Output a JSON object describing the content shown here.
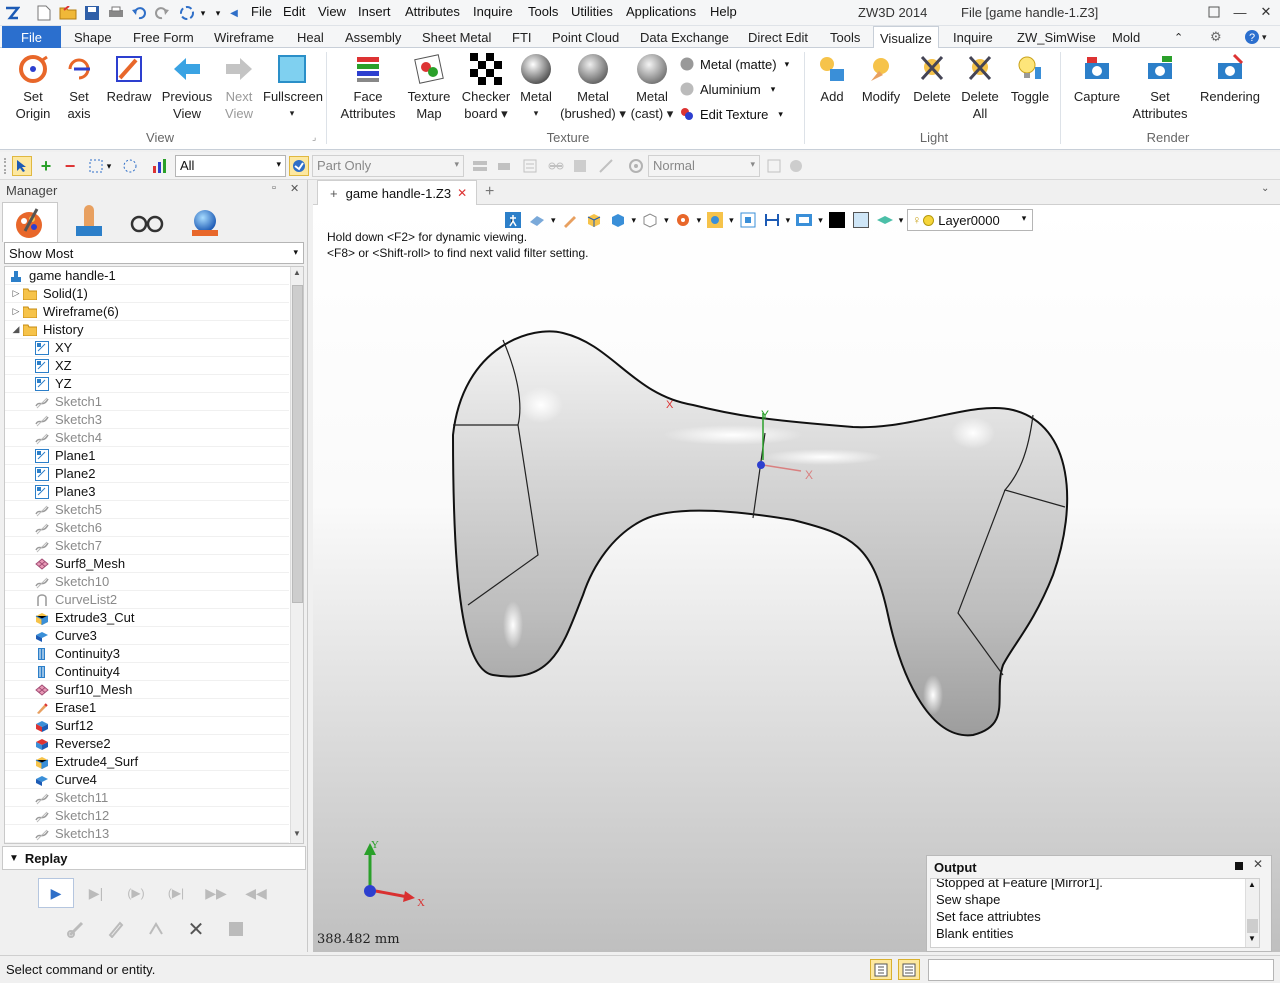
{
  "titlebar": {
    "menus": [
      "File",
      "Edit",
      "View",
      "Insert",
      "Attributes",
      "Inquire",
      "Tools",
      "Utilities",
      "Applications",
      "Help"
    ],
    "app_name": "ZW3D 2014",
    "file_title": "File [game handle-1.Z3]"
  },
  "tabs": [
    "File",
    "Shape",
    "Free Form",
    "Wireframe",
    "Heal",
    "Sheet Metal",
    "Assembly",
    "Sheet Metal",
    "FTI",
    "Point Cloud",
    "Data Exchange",
    "Direct Edit",
    "Tools",
    "Visualize",
    "Inquire",
    "ZW_SimWise",
    "Mold"
  ],
  "tabs_visible": [
    "File",
    "Shape",
    "Free Form",
    "Wireframe",
    "Heal",
    "Assembly",
    "Sheet Metal",
    "FTI",
    "Point Cloud",
    "Data Exchange",
    "Direct Edit",
    "Tools",
    "Visualize",
    "Inquire",
    "ZW_SimWise",
    "Mold"
  ],
  "ribbon": {
    "view": {
      "set_origin": [
        "Set",
        "Origin"
      ],
      "set_axis": [
        "Set",
        "axis"
      ],
      "redraw": [
        "Redraw",
        ""
      ],
      "previous_view": [
        "Previous",
        "View"
      ],
      "next_view": [
        "Next",
        "View"
      ],
      "fullscreen": [
        "Fullscreen",
        "▾"
      ],
      "group": "View"
    },
    "texture": {
      "face_attributes": [
        "Face",
        "Attributes"
      ],
      "texture_map": [
        "Texture",
        "Map"
      ],
      "checker_board": [
        "Checker",
        "board ▾"
      ],
      "metal": [
        "Metal",
        "▾"
      ],
      "metal_brushed": [
        "Metal",
        "(brushed) ▾"
      ],
      "metal_cast": [
        "Metal",
        "(cast) ▾"
      ],
      "small": [
        "Metal (matte)",
        "Aluminium",
        "Edit Texture"
      ],
      "group": "Texture"
    },
    "light": {
      "add": "Add",
      "modify": "Modify",
      "delete": "Delete",
      "delete_all": [
        "Delete",
        "All"
      ],
      "toggle": "Toggle",
      "group": "Light"
    },
    "render": {
      "capture": "Capture",
      "set_attributes": [
        "Set",
        "Attributes"
      ],
      "rendering": "Rendering",
      "group": "Render"
    }
  },
  "toolbar": {
    "filter_value": "All",
    "part_only": "Part Only",
    "normal": "Normal"
  },
  "manager": {
    "title": "Manager",
    "show_filter": "Show Most",
    "tree": [
      {
        "label": "game handle-1",
        "icon": "part-icon",
        "state": "normal",
        "indent": 0,
        "exp": ""
      },
      {
        "label": "Solid(1)",
        "icon": "folder-icon",
        "state": "normal",
        "indent": 1,
        "exp": "▷"
      },
      {
        "label": "Wireframe(6)",
        "icon": "folder-icon",
        "state": "normal",
        "indent": 1,
        "exp": "▷"
      },
      {
        "label": "History",
        "icon": "folder-icon",
        "state": "normal",
        "indent": 1,
        "exp": "◢"
      },
      {
        "label": "XY",
        "icon": "plane-icon",
        "state": "normal",
        "indent": 2,
        "exp": ""
      },
      {
        "label": "XZ",
        "icon": "plane-icon",
        "state": "normal",
        "indent": 2,
        "exp": ""
      },
      {
        "label": "YZ",
        "icon": "plane-icon",
        "state": "normal",
        "indent": 2,
        "exp": ""
      },
      {
        "label": "Sketch1",
        "icon": "sketch-icon",
        "state": "gray",
        "indent": 2,
        "exp": ""
      },
      {
        "label": "Sketch3",
        "icon": "sketch-icon",
        "state": "gray",
        "indent": 2,
        "exp": ""
      },
      {
        "label": "Sketch4",
        "icon": "sketch-icon",
        "state": "gray",
        "indent": 2,
        "exp": ""
      },
      {
        "label": "Plane1",
        "icon": "plane-icon",
        "state": "normal",
        "indent": 2,
        "exp": ""
      },
      {
        "label": "Plane2",
        "icon": "plane-icon",
        "state": "normal",
        "indent": 2,
        "exp": ""
      },
      {
        "label": "Plane3",
        "icon": "plane-icon",
        "state": "normal",
        "indent": 2,
        "exp": ""
      },
      {
        "label": "Sketch5",
        "icon": "sketch-icon",
        "state": "gray",
        "indent": 2,
        "exp": ""
      },
      {
        "label": "Sketch6",
        "icon": "sketch-icon",
        "state": "gray",
        "indent": 2,
        "exp": ""
      },
      {
        "label": "Sketch7",
        "icon": "sketch-icon",
        "state": "gray",
        "indent": 2,
        "exp": ""
      },
      {
        "label": "Surf8_Mesh",
        "icon": "mesh-icon",
        "state": "normal",
        "indent": 2,
        "exp": ""
      },
      {
        "label": "Sketch10",
        "icon": "sketch-icon",
        "state": "gray",
        "indent": 2,
        "exp": ""
      },
      {
        "label": "CurveList2",
        "icon": "curvelist-icon",
        "state": "gray",
        "indent": 2,
        "exp": ""
      },
      {
        "label": "Extrude3_Cut",
        "icon": "extrude-icon",
        "state": "normal",
        "indent": 2,
        "exp": ""
      },
      {
        "label": "Curve3",
        "icon": "curve-icon",
        "state": "normal",
        "indent": 2,
        "exp": ""
      },
      {
        "label": "Continuity3",
        "icon": "continuity-icon",
        "state": "normal",
        "indent": 2,
        "exp": ""
      },
      {
        "label": "Continuity4",
        "icon": "continuity-icon",
        "state": "normal",
        "indent": 2,
        "exp": ""
      },
      {
        "label": "Surf10_Mesh",
        "icon": "mesh-icon",
        "state": "normal",
        "indent": 2,
        "exp": ""
      },
      {
        "label": "Erase1",
        "icon": "erase-icon",
        "state": "normal",
        "indent": 2,
        "exp": ""
      },
      {
        "label": "Surf12",
        "icon": "surface-icon",
        "state": "normal",
        "indent": 2,
        "exp": ""
      },
      {
        "label": "Reverse2",
        "icon": "reverse-icon",
        "state": "normal",
        "indent": 2,
        "exp": ""
      },
      {
        "label": "Extrude4_Surf",
        "icon": "extrude-icon",
        "state": "normal",
        "indent": 2,
        "exp": ""
      },
      {
        "label": "Curve4",
        "icon": "curve-icon",
        "state": "normal",
        "indent": 2,
        "exp": ""
      },
      {
        "label": "Sketch11",
        "icon": "sketch-icon",
        "state": "gray",
        "indent": 2,
        "exp": ""
      },
      {
        "label": "Sketch12",
        "icon": "sketch-icon",
        "state": "gray",
        "indent": 2,
        "exp": ""
      },
      {
        "label": "Sketch13",
        "icon": "sketch-icon",
        "state": "gray",
        "indent": 2,
        "exp": ""
      }
    ],
    "replay_title": "Replay"
  },
  "document": {
    "tab_label": "game handle-1.Z3",
    "hint_line1": "Hold down <F2> for dynamic viewing.",
    "hint_line2": "<F8> or <Shift-roll> to find next valid filter setting.",
    "layer": "Layer0000",
    "scale_readout": "388.482 mm",
    "axis_x": "X",
    "axis_y": "Y"
  },
  "output": {
    "title": "Output",
    "lines": [
      "Stopped at Feature [Mirror1].",
      "Sew shape",
      "Set face attriubtes",
      "Blank entities"
    ]
  },
  "status": {
    "prompt": "Select command or entity."
  },
  "colors": {
    "file_tab": "#2b6fce",
    "accent_orange": "#e8672a",
    "axis_x": "#d93030",
    "axis_y": "#2aa02a",
    "axis_z": "#2d3fcf"
  }
}
